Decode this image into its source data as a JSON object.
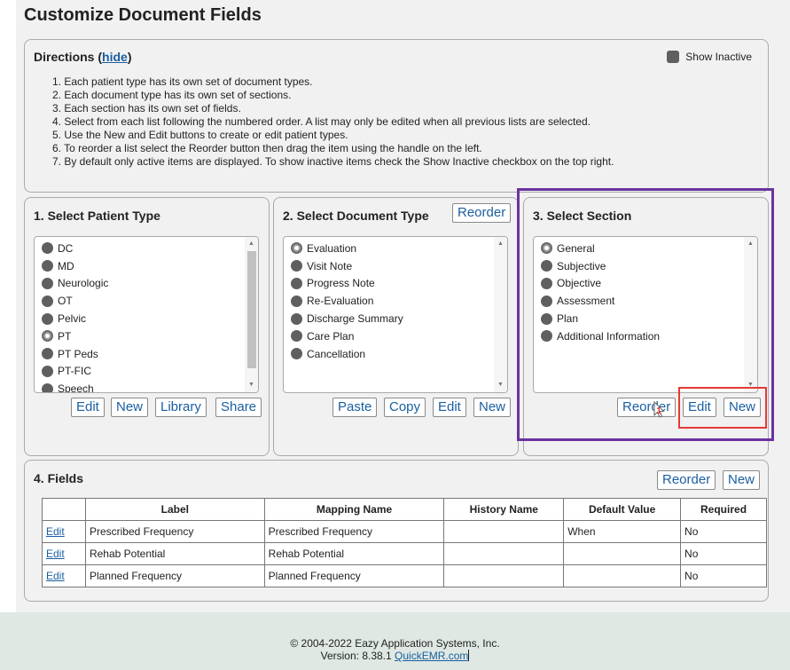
{
  "page": {
    "title": "Customize Document Fields"
  },
  "directions": {
    "title": "Directions",
    "hide_link": "hide",
    "show_inactive_label": "Show Inactive",
    "items": [
      "1. Each patient type has its own set of document types.",
      "2. Each document type has its own set of sections.",
      "3. Each section has its own set of fields.",
      "4. Select from each list following the numbered order. A list may only be edited when all previous lists are selected.",
      "5. Use the New and Edit buttons to create or edit patient types.",
      "6. To reorder a list select the Reorder button then drag the item using the handle on the left.",
      "7. By default only active items are displayed. To show inactive items check the Show Inactive checkbox on the top right."
    ]
  },
  "patient_type": {
    "title": "1. Select Patient Type",
    "items": [
      "DC",
      "MD",
      "Neurologic",
      "OT",
      "Pelvic",
      "PT",
      "PT Peds",
      "PT-FIC",
      "Speech"
    ],
    "selected": "PT",
    "buttons": {
      "edit": "Edit",
      "new": "New",
      "library": "Library",
      "share": "Share"
    }
  },
  "document_type": {
    "title": "2. Select Document Type",
    "reorder": "Reorder",
    "items": [
      "Evaluation",
      "Visit Note",
      "Progress Note",
      "Re-Evaluation",
      "Discharge Summary",
      "Care Plan",
      "Cancellation"
    ],
    "selected": "Evaluation",
    "buttons": {
      "paste": "Paste",
      "copy": "Copy",
      "edit": "Edit",
      "new": "New"
    }
  },
  "section": {
    "title": "3. Select Section",
    "items": [
      "General",
      "Subjective",
      "Objective",
      "Assessment",
      "Plan",
      "Additional Information"
    ],
    "selected": "General",
    "buttons": {
      "reorder": "Reorder",
      "edit": "Edit",
      "new": "New"
    },
    "cursor_badge": "1"
  },
  "fields": {
    "title": "4. Fields",
    "reorder": "Reorder",
    "new": "New",
    "columns": [
      "",
      "Label",
      "Mapping Name",
      "History Name",
      "Default Value",
      "Required"
    ],
    "rows": [
      {
        "action": "Edit",
        "label": "Prescribed Frequency",
        "mapping": "Prescribed Frequency",
        "history": "",
        "default": "When",
        "required": "No"
      },
      {
        "action": "Edit",
        "label": "Rehab Potential",
        "mapping": "Rehab Potential",
        "history": "",
        "default": "",
        "required": "No"
      },
      {
        "action": "Edit",
        "label": "Planned Frequency",
        "mapping": "Planned Frequency",
        "history": "",
        "default": "",
        "required": "No"
      }
    ]
  },
  "footer": {
    "copyright": "© 2004-2022 Eazy Application Systems, Inc.",
    "version_prefix": "Version: 8.38.1",
    "link": "QuickEMR.com"
  },
  "colors": {
    "highlight_purple": "#6a33a0",
    "highlight_red": "#e53935",
    "link_blue": "#1a5fa0"
  }
}
